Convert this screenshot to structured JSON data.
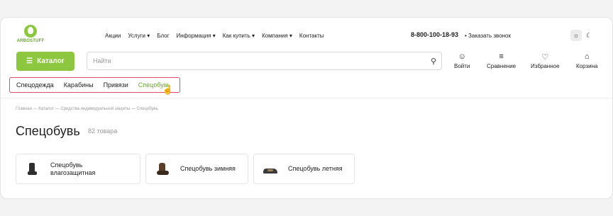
{
  "brand": {
    "name": "ARBOSTUFF",
    "color": "#8dc63f"
  },
  "topnav": [
    {
      "label": "Акции",
      "dropdown": false
    },
    {
      "label": "Услуги",
      "dropdown": true
    },
    {
      "label": "Блог",
      "dropdown": false
    },
    {
      "label": "Информация",
      "dropdown": true
    },
    {
      "label": "Как купить",
      "dropdown": true
    },
    {
      "label": "Компания",
      "dropdown": true
    },
    {
      "label": "Контакты",
      "dropdown": false
    }
  ],
  "header": {
    "phone": "8-800-100-18-93",
    "callback": "Заказать звонок"
  },
  "catalog_button": {
    "label": "Каталог",
    "icon": "menu-icon"
  },
  "search": {
    "placeholder": "Найти",
    "icon": "search-icon"
  },
  "actions": [
    {
      "label": "Войти",
      "icon": "user-icon"
    },
    {
      "label": "Сравнение",
      "icon": "compare-icon"
    },
    {
      "label": "Избранное",
      "icon": "heart-icon"
    },
    {
      "label": "Корзина",
      "icon": "cart-icon"
    }
  ],
  "category_tabs": [
    {
      "label": "Спецодежда",
      "active": false
    },
    {
      "label": "Карабины",
      "active": false
    },
    {
      "label": "Привязи",
      "active": false
    },
    {
      "label": "Спецобувь",
      "active": true
    }
  ],
  "breadcrumb": [
    "Главная",
    "Каталог",
    "Средства индивидуальной защиты",
    "Спецобувь"
  ],
  "breadcrumb_separator": "—",
  "page": {
    "title": "Спецобувь",
    "count": "82 товара"
  },
  "subcategories": [
    {
      "label": "Спецобувь влагозащитная",
      "icon": "rubber-boot-icon"
    },
    {
      "label": "Спецобувь зимняя",
      "icon": "winter-boot-icon"
    },
    {
      "label": "Спецобувь летняя",
      "icon": "summer-shoe-icon"
    }
  ],
  "colors": {
    "accent": "#8dc63f",
    "highlight_border": "#e54a6a"
  }
}
